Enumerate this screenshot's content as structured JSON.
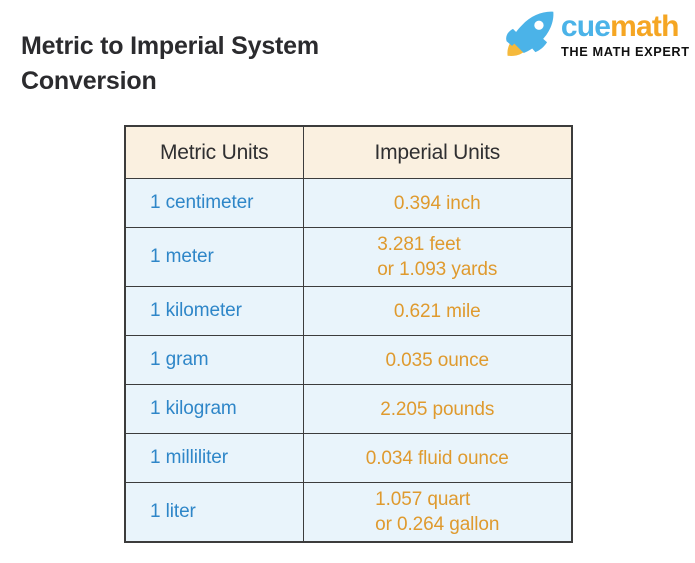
{
  "page": {
    "title_line1": "Metric to Imperial System",
    "title_line2": "Conversion",
    "background_color": "#ffffff"
  },
  "logo": {
    "icon_name": "rocket-icon",
    "word_part1": "cue",
    "word_part2": "math",
    "tagline": "THE MATH EXPERT",
    "colors": {
      "blue": "#4bb3e8",
      "orange": "#f5a623",
      "flame": "#f5b93c",
      "tagline": "#111111"
    }
  },
  "table": {
    "headers": {
      "metric": "Metric Units",
      "imperial": "Imperial Units"
    },
    "colors": {
      "header_background": "#faf0e0",
      "row_background": "#e9f4fb",
      "border": "#3c3c3c",
      "metric_text": "#2e86c8",
      "imperial_text": "#df9a2e",
      "header_text": "#2f2f31"
    },
    "rows": [
      {
        "metric": "1 centimeter",
        "imperial_lines": [
          "0.394 inch"
        ]
      },
      {
        "metric": "1 meter",
        "imperial_lines": [
          "3.281 feet",
          "or 1.093 yards"
        ]
      },
      {
        "metric": "1 kilometer",
        "imperial_lines": [
          "0.621 mile"
        ]
      },
      {
        "metric": "1 gram",
        "imperial_lines": [
          "0.035 ounce"
        ]
      },
      {
        "metric": "1 kilogram",
        "imperial_lines": [
          "2.205 pounds"
        ]
      },
      {
        "metric": "1 milliliter",
        "imperial_lines": [
          "0.034 fluid ounce"
        ]
      },
      {
        "metric": "1 liter",
        "imperial_lines": [
          "1.057 quart",
          "or 0.264 gallon"
        ]
      }
    ]
  }
}
